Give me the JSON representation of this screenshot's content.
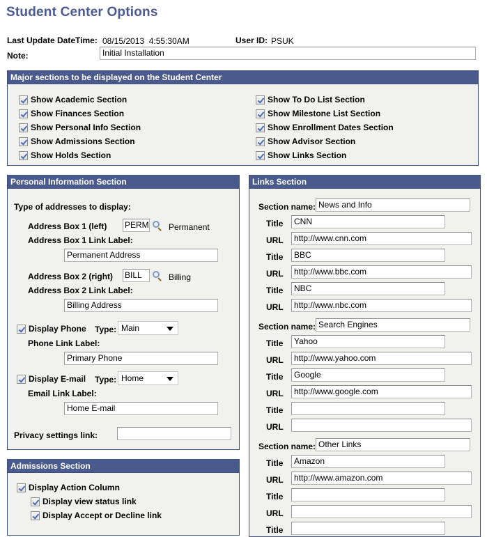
{
  "page": {
    "title": "Student Center Options",
    "last_update_label": "Last Update DateTime:",
    "last_update_value": "08/15/2013  4:55:30AM",
    "user_id_label": "User ID:",
    "user_id_value": "PSUK",
    "note_label": "Note:",
    "note_value": "Initial Installation"
  },
  "major_sections": {
    "header": "Major sections to be displayed on the Student Center",
    "left": [
      {
        "label": "Show Academic Section",
        "checked": true
      },
      {
        "label": "Show Finances Section",
        "checked": true
      },
      {
        "label": "Show Personal Info Section",
        "checked": true
      },
      {
        "label": "Show Admissions Section",
        "checked": true
      },
      {
        "label": "Show Holds Section",
        "checked": true
      }
    ],
    "right": [
      {
        "label": "Show To Do List Section",
        "checked": true
      },
      {
        "label": "Show Milestone List Section",
        "checked": true
      },
      {
        "label": "Show Enrollment Dates Section",
        "checked": true
      },
      {
        "label": "Show Advisor Section",
        "checked": true
      },
      {
        "label": "Show Links Section",
        "checked": true
      }
    ]
  },
  "personal_info": {
    "header": "Personal Information Section",
    "address_types_label": "Type of addresses to display:",
    "addr1_label": "Address Box 1 (left)",
    "addr1_code": "PERM",
    "addr1_desc": "Permanent",
    "addr1_link_label": "Address Box 1 Link Label:",
    "addr1_link_value": "Permanent Address",
    "addr2_label": "Address Box 2 (right)",
    "addr2_code": "BILL",
    "addr2_desc": "Billing",
    "addr2_link_label": "Address Box 2 Link Label:",
    "addr2_link_value": "Billing Address",
    "phone_check_label": "Display Phone",
    "phone_checked": true,
    "phone_type_label": "Type:",
    "phone_type_value": "Main",
    "phone_link_label": "Phone Link Label:",
    "phone_link_value": "Primary Phone",
    "email_check_label": "Display E-mail",
    "email_checked": true,
    "email_type_label": "Type:",
    "email_type_value": "Home",
    "email_link_label": "Email Link Label:",
    "email_link_value": "Home E-mail",
    "privacy_label": "Privacy settings link:",
    "privacy_value": ""
  },
  "admissions": {
    "header": "Admissions Section",
    "action_column": {
      "label": "Display Action Column",
      "checked": true
    },
    "view_status": {
      "label": "Display view status link",
      "checked": true
    },
    "accept_decline": {
      "label": "Display Accept or Decline link",
      "checked": true
    }
  },
  "links": {
    "header": "Links Section",
    "section_name_label": "Section name:",
    "title_label": "Title",
    "url_label": "URL",
    "groups": [
      {
        "name": "News and Info",
        "items": [
          {
            "title": "CNN",
            "url": "http://www.cnn.com"
          },
          {
            "title": "BBC",
            "url": "http://www.bbc.com"
          },
          {
            "title": "NBC",
            "url": "http://www.nbc.com"
          }
        ]
      },
      {
        "name": "Search Engines",
        "items": [
          {
            "title": "Yahoo",
            "url": "http://www.yahoo.com"
          },
          {
            "title": "Google",
            "url": "http://www.google.com"
          },
          {
            "title": "",
            "url": ""
          }
        ]
      },
      {
        "name": "Other Links",
        "items": [
          {
            "title": "Amazon",
            "url": "http://www.amazon.com"
          },
          {
            "title": "",
            "url": ""
          },
          {
            "title": "",
            "url": ""
          }
        ]
      }
    ]
  }
}
